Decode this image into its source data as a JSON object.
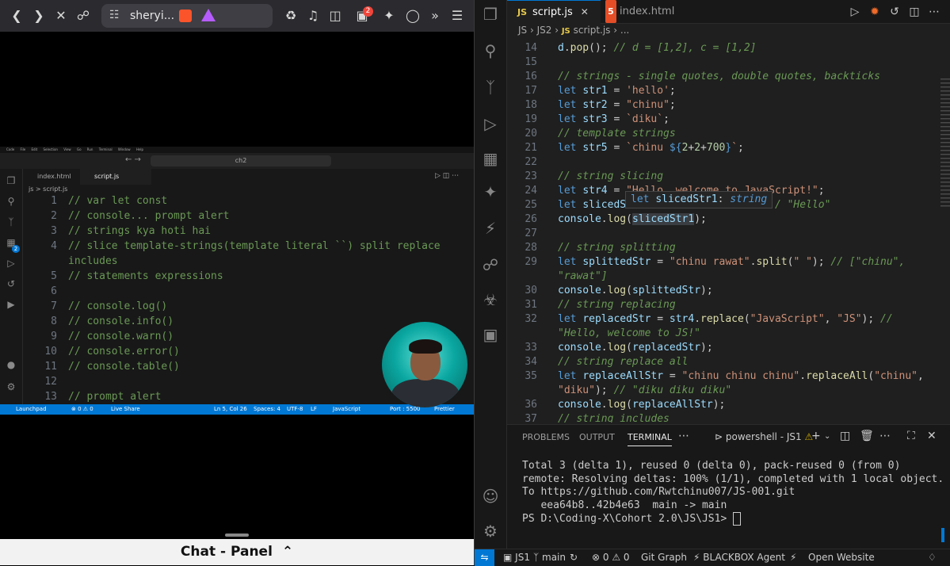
{
  "browser": {
    "url_text": "sheryi...",
    "extension_badge": "2",
    "mac_menubar": [
      "Code",
      "File",
      "Edit",
      "Selection",
      "View",
      "Go",
      "Run",
      "Terminal",
      "Window",
      "Help"
    ],
    "chat_panel_label": "Chat - Panel"
  },
  "inner_editor": {
    "search": "ch2",
    "tabs": [
      "index.html",
      "script.js"
    ],
    "breadcrumb": "js > script.js",
    "activity_badge": "2",
    "lines": [
      {
        "n": "1",
        "t": "// var let const"
      },
      {
        "n": "2",
        "t": "// console... prompt alert"
      },
      {
        "n": "3",
        "t": "// strings kya hoti hai"
      },
      {
        "n": "4",
        "t": "// slice template-strings(template literal ``) split replace"
      },
      {
        "n": "",
        "t": "includes"
      },
      {
        "n": "5",
        "t": "// statements expressions"
      },
      {
        "n": "6",
        "t": ""
      },
      {
        "n": "7",
        "t": "// console.log()"
      },
      {
        "n": "8",
        "t": "// console.info()"
      },
      {
        "n": "9",
        "t": "// console.warn()"
      },
      {
        "n": "10",
        "t": "// console.error()"
      },
      {
        "n": "11",
        "t": "// console.table()"
      },
      {
        "n": "12",
        "t": ""
      },
      {
        "n": "13",
        "t": "// prompt alert"
      }
    ],
    "status": {
      "launchpad": "Launchpad",
      "problems": "⊗ 0 ⚠ 0",
      "live": "Live Share",
      "pos": "Ln 5, Col 26",
      "spaces": "Spaces: 4",
      "enc": "UTF-8",
      "eol": "LF",
      "lang": "JavaScript",
      "port": "Port : 5500",
      "prettier": "Prettier"
    }
  },
  "vscode": {
    "tabs": [
      {
        "icon": "JS",
        "label": "script.js",
        "active": true
      },
      {
        "icon": "5",
        "label": "index.html",
        "active": false
      }
    ],
    "breadcrumb": [
      "JS",
      "JS2",
      "script.js",
      "..."
    ],
    "hover": {
      "kw": "let",
      "name": "slicedStr1",
      "type": "string"
    },
    "panel_tabs": [
      "PROBLEMS",
      "OUTPUT",
      "TERMINAL"
    ],
    "terminal_name": "powershell - JS1",
    "terminal_lines": [
      "Total 3 (delta 1), reused 0 (delta 0), pack-reused 0 (from 0)",
      "remote: Resolving deltas: 100% (1/1), completed with 1 local object.",
      "To https://github.com/Rwtchinu007/JS-001.git",
      "   eea64b8..42b4e63  main -> main",
      "PS D:\\Coding-X\\Cohort 2.0\\JS\\JS1> "
    ],
    "status": {
      "folder": "JS1",
      "branch": "main",
      "problems": "⊗ 0 ⚠ 0",
      "git_graph": "Git Graph",
      "blackbox": "BLACKBOX Agent",
      "open_website": "Open Website"
    }
  },
  "colors": {
    "accent": "#0078d4",
    "keyword": "#569cd6",
    "string": "#ce9178",
    "comment": "#6a9955",
    "function": "#dcdcaa"
  }
}
